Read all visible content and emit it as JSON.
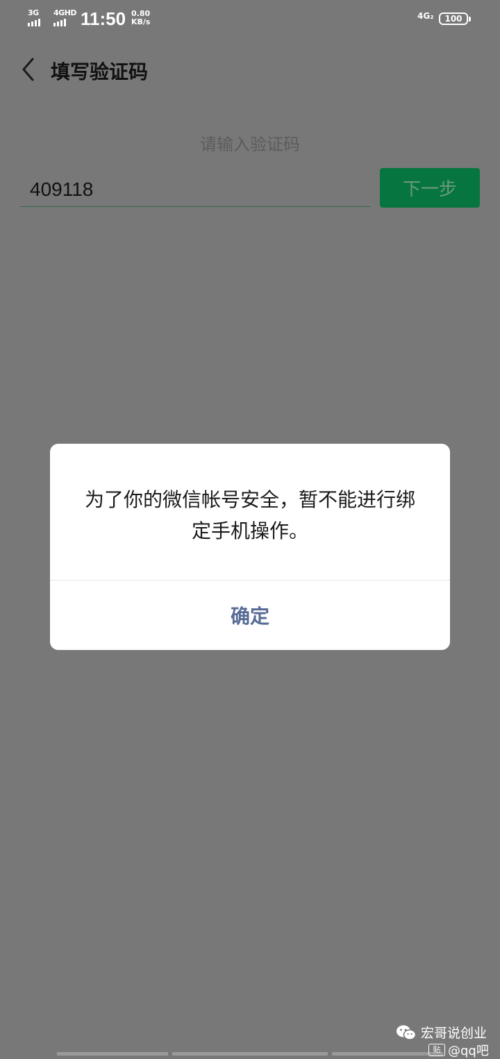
{
  "status_bar": {
    "signal1_label": "3G",
    "signal2_label": "4GHD",
    "time": "11:50",
    "speed_value": "0.80",
    "speed_unit": "KB/s",
    "network_right": "4G₂",
    "battery": "100"
  },
  "header": {
    "title": "填写验证码"
  },
  "form": {
    "prompt": "请输入验证码",
    "code_value": "409118",
    "next_label": "下一步"
  },
  "dialog": {
    "message": "为了你的微信帐号安全，暂不能进行绑定手机操作。",
    "confirm_label": "确定"
  },
  "watermark": {
    "line1": "宏哥说创业",
    "line2": "@qq吧",
    "badge": "贴"
  },
  "colors": {
    "overlay_bg": "#787878",
    "button_green": "#06753f",
    "confirm_blue": "#576b95"
  },
  "icons": {
    "back": "chevron-left-icon",
    "wechat": "wechat-icon"
  }
}
